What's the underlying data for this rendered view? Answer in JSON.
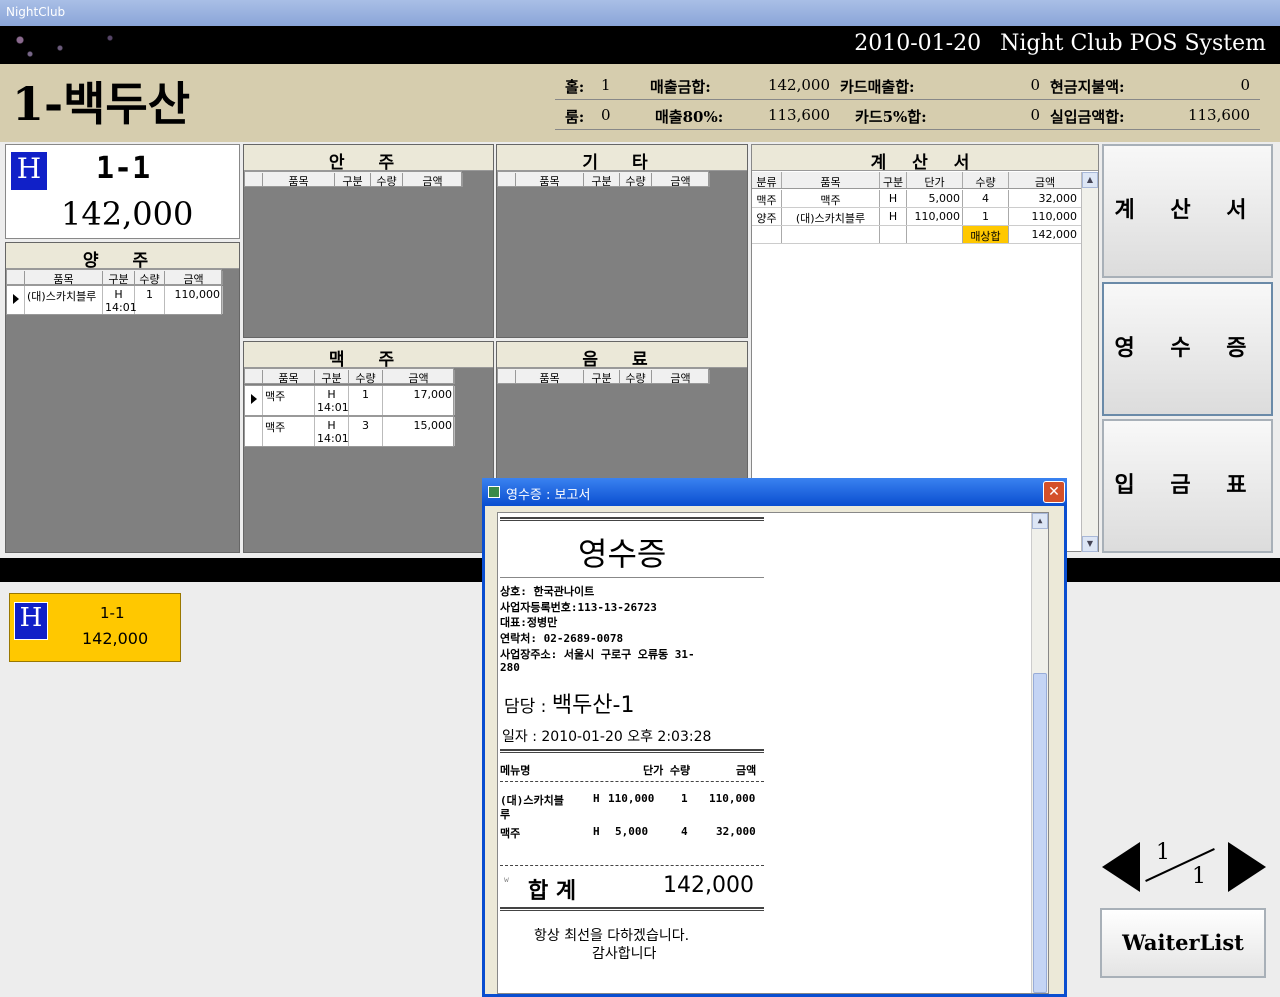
{
  "window": {
    "title": "NightClub"
  },
  "header": {
    "date": "2010-01-20",
    "system_name": "Night Club POS System"
  },
  "table_name": "1-백두산",
  "summary": {
    "hall_label": "홀:",
    "hall_value": "1",
    "room_label": "룸:",
    "room_value": "0",
    "sales_total_label": "매출금합:",
    "sales_total_value": "142,000",
    "sales80_label": "매출80%:",
    "sales80_value": "113,600",
    "card_sales_label": "카드매출합:",
    "card_sales_value": "0",
    "card5_label": "카드5%합:",
    "card5_value": "0",
    "cash_out_label": "현금지불액:",
    "cash_out_value": "0",
    "actual_in_label": "실입금액합:",
    "actual_in_value": "113,600"
  },
  "current_table": {
    "badge": "H",
    "name": "1-1",
    "amount": "142,000"
  },
  "grid_columns": {
    "item": "품목",
    "type": "구분",
    "qty": "수량",
    "amount": "금액"
  },
  "panels": {
    "liquor": {
      "title": "양 주",
      "rows": [
        {
          "item": "(대)스카치블루",
          "type": "H",
          "time": "14:01",
          "qty": "1",
          "amount": "110,000"
        }
      ]
    },
    "snacks": {
      "title": "안 주",
      "rows": []
    },
    "etc": {
      "title": "기 타",
      "rows": []
    },
    "beer": {
      "title": "맥 주",
      "rows": [
        {
          "item": "맥주",
          "type": "H",
          "time": "14:01",
          "qty": "1",
          "amount": "17,000"
        },
        {
          "item": "맥주",
          "type": "H",
          "time": "14:01",
          "qty": "3",
          "amount": "15,000"
        }
      ]
    },
    "drinks": {
      "title": "음 료",
      "rows": []
    }
  },
  "bill": {
    "title": "계 산 서",
    "columns": {
      "category": "분류",
      "item": "품목",
      "type": "구분",
      "unit_price": "단가",
      "qty": "수량",
      "amount": "금액"
    },
    "rows": [
      {
        "category": "맥주",
        "item": "맥주",
        "type": "H",
        "unit_price": "5,000",
        "qty": "4",
        "amount": "32,000"
      },
      {
        "category": "양주",
        "item": "(대)스카치블루",
        "type": "H",
        "unit_price": "110,000",
        "qty": "1",
        "amount": "110,000"
      }
    ],
    "total_label": "매상합",
    "total_value": "142,000"
  },
  "buttons": {
    "bill": "계 산 서",
    "receipt": "영 수 증",
    "deposit": "입 금 표",
    "waiter_list": "WaiterList"
  },
  "table_card": {
    "badge": "H",
    "name": "1-1",
    "amount": "142,000"
  },
  "pager": {
    "current": "1",
    "total": "1"
  },
  "receipt_dialog": {
    "title": "영수증 : 보고서",
    "close": "✕",
    "heading": "영수증",
    "shop": "상호: 한국관나이트",
    "biz_no": "사업자등록번호:113-13-26723",
    "owner": "대표:정병만",
    "phone": "연락처: 02-2689-0078",
    "address_1": "사업장주소: 서울시 구로구 오류동 31-",
    "address_2": "280",
    "staff_label": "담당 :",
    "staff_value": "백두산-1",
    "date_label": "일자 :",
    "date_value": "2010-01-20 오후 2:03:28",
    "col_menu": "메뉴명",
    "col_price_qty": "단가 수량",
    "col_amount": "금액",
    "items": [
      {
        "name": "(대)스카치블",
        "name2": "루",
        "type": "H",
        "price": "110,000",
        "qty": "1",
        "amount": "110,000"
      },
      {
        "name": "맥주",
        "name2": "",
        "type": "H",
        "price": "5,000",
        "qty": "4",
        "amount": "32,000"
      }
    ],
    "mark": "w",
    "total_label": "합 계",
    "total_value": "142,000",
    "thanks_1": "항상 최선을 다하겠습니다.",
    "thanks_2": "감사합니다"
  },
  "icons": {
    "arrow_left": "arrow-left-icon",
    "arrow_right": "arrow-right-icon",
    "row_pointer": "row-pointer-icon"
  }
}
